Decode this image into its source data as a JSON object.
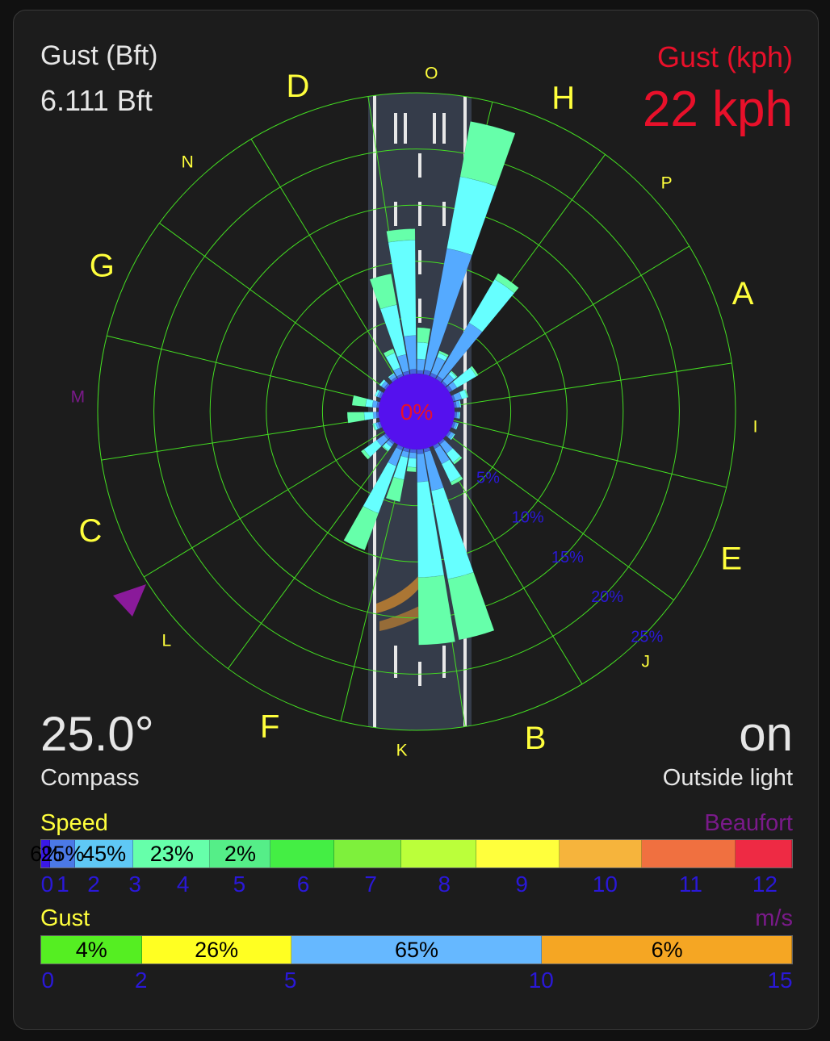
{
  "header": {
    "left_title": "Gust (Bft)",
    "left_value": "6.111 Bft",
    "right_title": "Gust (kph)",
    "right_value": "22 kph"
  },
  "footer": {
    "left_value": "25.0°",
    "left_label": "Compass",
    "right_value": "on",
    "right_label": "Outside light"
  },
  "colors": {
    "yellow": "#ffff3c",
    "red": "#e8102a",
    "purple": "#7a1a8a",
    "blue_text": "#2a18d8",
    "grid": "#44dd22",
    "center": "#5511ee",
    "calm": "#4466dd",
    "band_lightblue": "#55aaff",
    "band_cyan": "#66ffff",
    "band_mint": "#66ffaa"
  },
  "chart_data": [
    {
      "type": "windrose",
      "center_label": "0%",
      "direction_labels": [
        "H",
        "P",
        "A",
        "I",
        "E",
        "J",
        "B",
        "K",
        "F",
        "L",
        "C",
        "M",
        "G",
        "N",
        "D",
        "O"
      ],
      "radial_ticks": [
        "5%",
        "10%",
        "15%",
        "20%",
        "25%"
      ],
      "radial_max": 25,
      "compass_deg": 25.0,
      "bands": [
        "calm",
        "band_lightblue",
        "band_cyan",
        "band_mint"
      ],
      "sectors": [
        {
          "dir": 5,
          "values": [
            0.3,
            1.0,
            1.5,
            1.3
          ]
        },
        {
          "dir": 15,
          "values": [
            0.4,
            11.0,
            6.5,
            5.0
          ]
        },
        {
          "dir": 25,
          "values": [
            0.3,
            1.5,
            0.4,
            0.2
          ]
        },
        {
          "dir": 35,
          "values": [
            0.3,
            5.5,
            4.5,
            0.6
          ]
        },
        {
          "dir": 45,
          "values": [
            0.2,
            0.8,
            0.3,
            0.1
          ]
        },
        {
          "dir": 55,
          "values": [
            0.3,
            0.5,
            2.0,
            0.2
          ]
        },
        {
          "dir": 70,
          "values": [
            0.2,
            0.6,
            0.5,
            0.1
          ]
        },
        {
          "dir": 80,
          "values": [
            0.2,
            0.3,
            0.1,
            0.0
          ]
        },
        {
          "dir": 95,
          "values": [
            0.2,
            0.2,
            0.1,
            0.0
          ]
        },
        {
          "dir": 110,
          "values": [
            0.2,
            0.2,
            0.1,
            0.0
          ]
        },
        {
          "dir": 125,
          "values": [
            0.2,
            0.3,
            0.1,
            0.0
          ]
        },
        {
          "dir": 140,
          "values": [
            0.2,
            1.0,
            1.0,
            0.2
          ]
        },
        {
          "dir": 150,
          "values": [
            0.3,
            1.5,
            1.8,
            0.3
          ]
        },
        {
          "dir": 165,
          "values": [
            0.3,
            3.5,
            8.0,
            5.5
          ]
        },
        {
          "dir": 175,
          "values": [
            0.4,
            2.5,
            8.5,
            6.0
          ]
        },
        {
          "dir": 185,
          "values": [
            0.3,
            0.5,
            0.8,
            0.4
          ]
        },
        {
          "dir": 195,
          "values": [
            0.3,
            0.5,
            2.0,
            2.0
          ]
        },
        {
          "dir": 205,
          "values": [
            0.3,
            1.5,
            4.5,
            3.5
          ]
        },
        {
          "dir": 220,
          "values": [
            0.2,
            0.3,
            0.4,
            0.1
          ]
        },
        {
          "dir": 230,
          "values": [
            0.2,
            0.8,
            1.4,
            0.3
          ]
        },
        {
          "dir": 250,
          "values": [
            0.2,
            0.2,
            0.2,
            0.1
          ]
        },
        {
          "dir": 265,
          "values": [
            0.2,
            0.3,
            0.8,
            1.5
          ]
        },
        {
          "dir": 280,
          "values": [
            0.2,
            0.4,
            0.6,
            1.2
          ]
        },
        {
          "dir": 295,
          "values": [
            0.2,
            0.2,
            0.2,
            0.0
          ]
        },
        {
          "dir": 310,
          "values": [
            0.2,
            0.3,
            0.2,
            0.0
          ]
        },
        {
          "dir": 325,
          "values": [
            0.2,
            0.3,
            0.1,
            0.0
          ]
        },
        {
          "dir": 335,
          "values": [
            0.2,
            0.6,
            1.4,
            0.4
          ]
        },
        {
          "dir": 345,
          "values": [
            0.3,
            1.5,
            4.5,
            2.8
          ]
        },
        {
          "dir": 355,
          "values": [
            0.4,
            3.0,
            8.5,
            1.0
          ]
        }
      ]
    },
    {
      "type": "bar",
      "name": "speed-scale",
      "title": "Speed",
      "unit": "Beaufort",
      "ticks": [
        "0",
        "1",
        "2",
        "3",
        "4",
        "5",
        "6",
        "7",
        "8",
        "9",
        "10",
        "11",
        "12"
      ],
      "segments": [
        {
          "label": "6%",
          "color": "#3a18e8"
        },
        {
          "label": "25%",
          "color": "#4b79e6"
        },
        {
          "label": "45%",
          "color": "#5fc8f5"
        },
        {
          "label": "23%",
          "color": "#66ffaa"
        },
        {
          "label": "2%",
          "color": "#55ee88"
        },
        {
          "label": "",
          "color": "#44ee44"
        },
        {
          "label": "",
          "color": "#7ef03c"
        },
        {
          "label": "",
          "color": "#bbff3a"
        },
        {
          "label": "",
          "color": "#ffff3c"
        },
        {
          "label": "",
          "color": "#f6b43c"
        },
        {
          "label": "",
          "color": "#f07040"
        },
        {
          "label": "",
          "color": "#ee2a44"
        }
      ]
    },
    {
      "type": "bar",
      "name": "gust-scale",
      "title": "Gust",
      "unit": "m/s",
      "ticks": [
        "0",
        "2",
        "5",
        "10",
        "15"
      ],
      "segments": [
        {
          "label": "4%",
          "color": "#55ee22"
        },
        {
          "label": "26%",
          "color": "#ffff22"
        },
        {
          "label": "65%",
          "color": "#66b8ff"
        },
        {
          "label": "6%",
          "color": "#f5a623"
        }
      ]
    }
  ]
}
